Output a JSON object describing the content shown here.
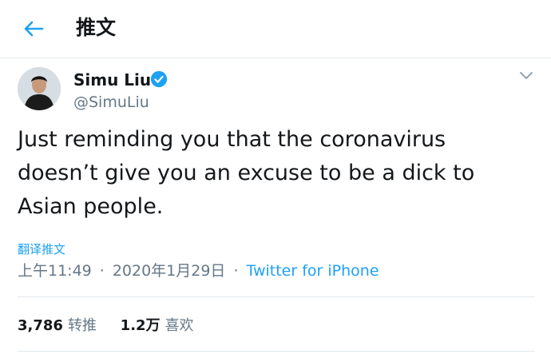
{
  "header": {
    "title": "推文"
  },
  "author": {
    "name": "Simu Liu",
    "handle": "@SimuLiu"
  },
  "tweet": {
    "text": "Just reminding you that the coronavirus\ndoesn’t give you an excuse to be a dick to\nAsian people."
  },
  "translate_label": "翻译推文",
  "meta": {
    "time": "上午11:49",
    "separator": "·",
    "date": "2020年1月29日",
    "source": "Twitter for iPhone"
  },
  "stats": {
    "retweets_count": "3,786",
    "retweets_label": "转推",
    "likes_count": "1.2万",
    "likes_label": "喜欢"
  },
  "colors": {
    "accent": "#1da1f2",
    "secondary_text": "#657786",
    "divider": "#e1e8ed"
  },
  "icons": {
    "back": "arrow-left-icon",
    "verified": "verified-badge-icon",
    "more": "chevron-down-icon"
  }
}
